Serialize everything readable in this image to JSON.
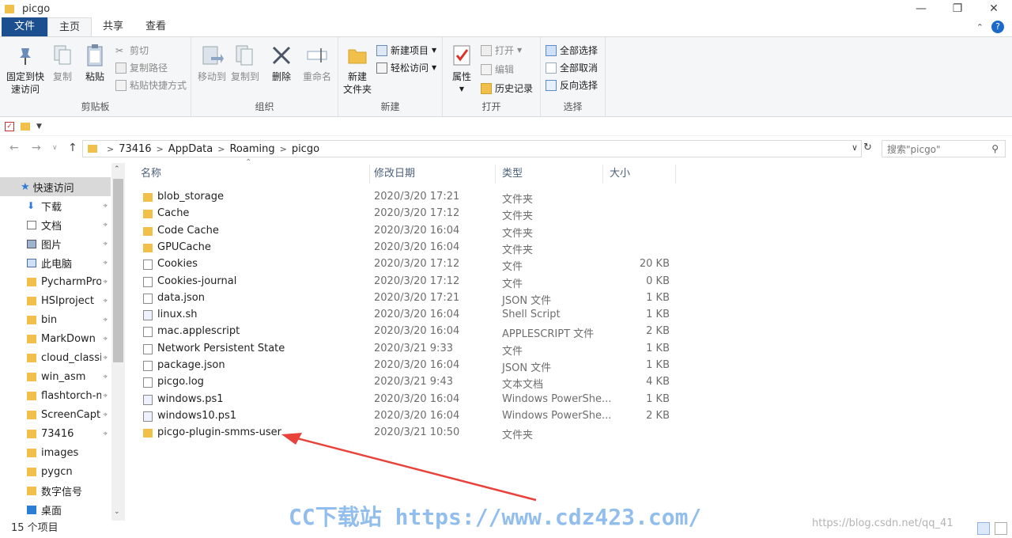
{
  "window": {
    "title": "picgo"
  },
  "ribbon_tabs": [
    "文件",
    "主页",
    "共享",
    "查看"
  ],
  "ribbon": {
    "clipboard": {
      "label": "剪贴板",
      "pin_line1": "固定到快",
      "pin_line2": "速访问",
      "copy": "复制",
      "paste": "粘贴",
      "cut": "剪切",
      "copy_path": "复制路径",
      "paste_shortcut": "粘贴快捷方式"
    },
    "organize": {
      "label": "组织",
      "move_to": "移动到",
      "copy_to": "复制到",
      "delete": "删除",
      "rename": "重命名"
    },
    "new": {
      "label": "新建",
      "new_folder_line1": "新建",
      "new_folder_line2": "文件夹",
      "new_item": "新建项目",
      "easy_access": "轻松访问"
    },
    "open": {
      "label": "打开",
      "properties": "属性",
      "open": "打开",
      "edit": "编辑",
      "history": "历史记录"
    },
    "select": {
      "label": "选择",
      "select_all": "全部选择",
      "select_none": "全部取消",
      "invert": "反向选择"
    }
  },
  "breadcrumb": [
    "73416",
    "AppData",
    "Roaming",
    "picgo"
  ],
  "search": {
    "placeholder": "搜索\"picgo\""
  },
  "sidebar": {
    "quick_access": "快速访问",
    "items": [
      {
        "label": "下载",
        "icon": "download-icon",
        "pinned": true
      },
      {
        "label": "文档",
        "icon": "document-icon",
        "pinned": true
      },
      {
        "label": "图片",
        "icon": "picture-icon",
        "pinned": true
      },
      {
        "label": "此电脑",
        "icon": "computer-icon",
        "pinned": true
      },
      {
        "label": "PycharmProj",
        "icon": "folder-icon",
        "pinned": true
      },
      {
        "label": "HSIproject",
        "icon": "folder-icon",
        "pinned": true
      },
      {
        "label": "bin",
        "icon": "folder-icon",
        "pinned": true
      },
      {
        "label": "MarkDown",
        "icon": "folder-icon",
        "pinned": true
      },
      {
        "label": "cloud_classif",
        "icon": "folder-icon",
        "pinned": true
      },
      {
        "label": "win_asm",
        "icon": "folder-icon",
        "pinned": true
      },
      {
        "label": "flashtorch-m",
        "icon": "folder-icon",
        "pinned": true
      },
      {
        "label": "ScreenCaptu",
        "icon": "folder-icon",
        "pinned": true
      },
      {
        "label": "73416",
        "icon": "folder-icon",
        "pinned": true
      },
      {
        "label": "images",
        "icon": "folder-icon",
        "pinned": false
      },
      {
        "label": "pygcn",
        "icon": "folder-icon",
        "pinned": false
      },
      {
        "label": "数字信号",
        "icon": "folder-icon",
        "pinned": false
      },
      {
        "label": "桌面",
        "icon": "desktop-icon",
        "pinned": false
      }
    ]
  },
  "columns": {
    "name": "名称",
    "modified": "修改日期",
    "type": "类型",
    "size": "大小"
  },
  "files": [
    {
      "name": "blob_storage",
      "modified": "2020/3/20 17:21",
      "type": "文件夹",
      "size": "",
      "icon": "folder"
    },
    {
      "name": "Cache",
      "modified": "2020/3/20 17:12",
      "type": "文件夹",
      "size": "",
      "icon": "folder"
    },
    {
      "name": "Code Cache",
      "modified": "2020/3/20 16:04",
      "type": "文件夹",
      "size": "",
      "icon": "folder"
    },
    {
      "name": "GPUCache",
      "modified": "2020/3/20 16:04",
      "type": "文件夹",
      "size": "",
      "icon": "folder"
    },
    {
      "name": "Cookies",
      "modified": "2020/3/20 17:12",
      "type": "文件",
      "size": "20 KB",
      "icon": "doc"
    },
    {
      "name": "Cookies-journal",
      "modified": "2020/3/20 17:12",
      "type": "文件",
      "size": "0 KB",
      "icon": "doc"
    },
    {
      "name": "data.json",
      "modified": "2020/3/20 17:21",
      "type": "JSON 文件",
      "size": "1 KB",
      "icon": "doc"
    },
    {
      "name": "linux.sh",
      "modified": "2020/3/20 16:04",
      "type": "Shell Script",
      "size": "1 KB",
      "icon": "script"
    },
    {
      "name": "mac.applescript",
      "modified": "2020/3/20 16:04",
      "type": "APPLESCRIPT 文件",
      "size": "2 KB",
      "icon": "doc"
    },
    {
      "name": "Network Persistent State",
      "modified": "2020/3/21 9:33",
      "type": "文件",
      "size": "1 KB",
      "icon": "doc"
    },
    {
      "name": "package.json",
      "modified": "2020/3/20 16:04",
      "type": "JSON 文件",
      "size": "1 KB",
      "icon": "doc"
    },
    {
      "name": "picgo.log",
      "modified": "2020/3/21 9:43",
      "type": "文本文档",
      "size": "4 KB",
      "icon": "doc"
    },
    {
      "name": "windows.ps1",
      "modified": "2020/3/20 16:04",
      "type": "Windows PowerShe...",
      "size": "1 KB",
      "icon": "script"
    },
    {
      "name": "windows10.ps1",
      "modified": "2020/3/20 16:04",
      "type": "Windows PowerShe...",
      "size": "2 KB",
      "icon": "script"
    },
    {
      "name": "picgo-plugin-smms-user",
      "modified": "2020/3/21 10:50",
      "type": "文件夹",
      "size": "",
      "icon": "folder"
    }
  ],
  "status": {
    "item_count": "15 个项目"
  },
  "watermark": {
    "brand": "CC下载站 https://www.cdz423.com/",
    "url": "https://blog.csdn.net/qq_41"
  },
  "colors": {
    "file_tab": "#1c4f8f",
    "folder": "#f0c04a",
    "annotation_arrow": "#e8423a"
  }
}
